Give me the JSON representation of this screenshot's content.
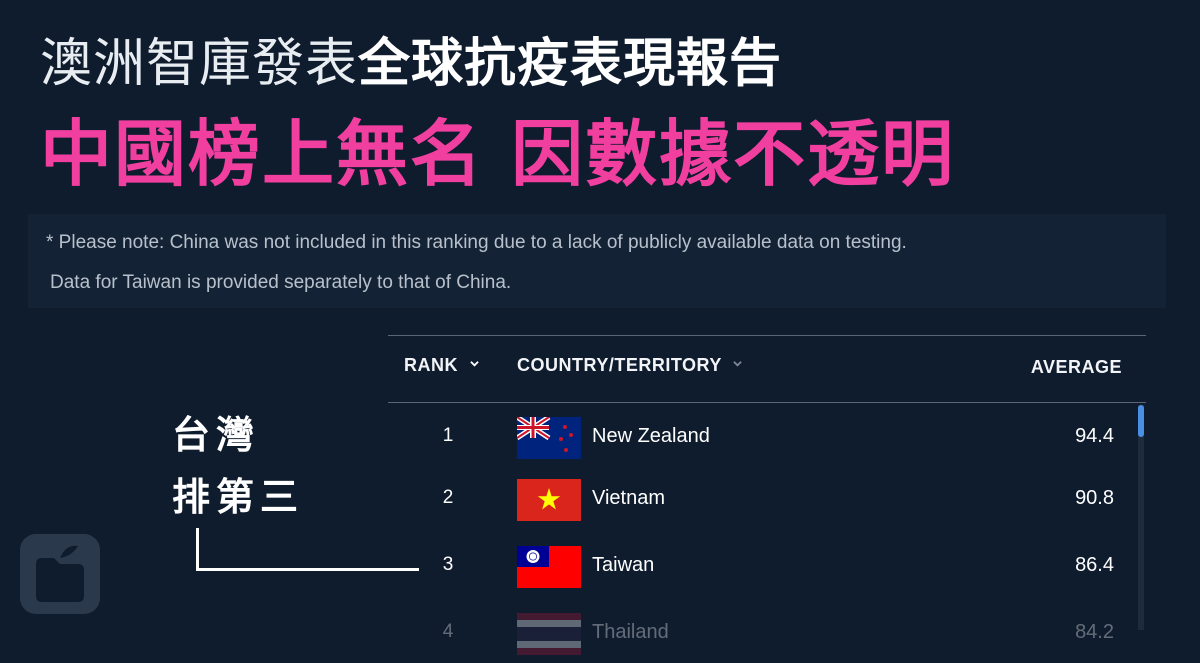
{
  "headline": {
    "line1_light": "澳洲智庫發表",
    "line1_bold": "全球抗疫表現報告",
    "line2": "中國榜上無名 因數據不透明"
  },
  "note": {
    "line1": "* Please note: China was not included in this ranking due to a lack of publicly available data on testing.",
    "line2": "Data for Taiwan is provided separately to that of China."
  },
  "table": {
    "headers": {
      "rank": "RANK",
      "country": "COUNTRY/TERRITORY",
      "average": "AVERAGE"
    },
    "rows": [
      {
        "rank": "1",
        "country": "New Zealand",
        "average": "94.4",
        "flag": "new-zealand-flag"
      },
      {
        "rank": "2",
        "country": "Vietnam",
        "average": "90.8",
        "flag": "vietnam-flag"
      },
      {
        "rank": "3",
        "country": "Taiwan",
        "average": "86.4",
        "flag": "taiwan-flag"
      },
      {
        "rank": "4",
        "country": "Thailand",
        "average": "84.2",
        "flag": "thailand-flag"
      }
    ]
  },
  "callout": {
    "line1": "台灣",
    "line2": "排第三"
  },
  "logo": {
    "icon": "apple-daily-logo-icon"
  },
  "colors": {
    "background": "#0f1c2e",
    "accent_pink": "#f13fa0",
    "note_box": "#132335",
    "scroll_thumb": "#4a90e2"
  }
}
